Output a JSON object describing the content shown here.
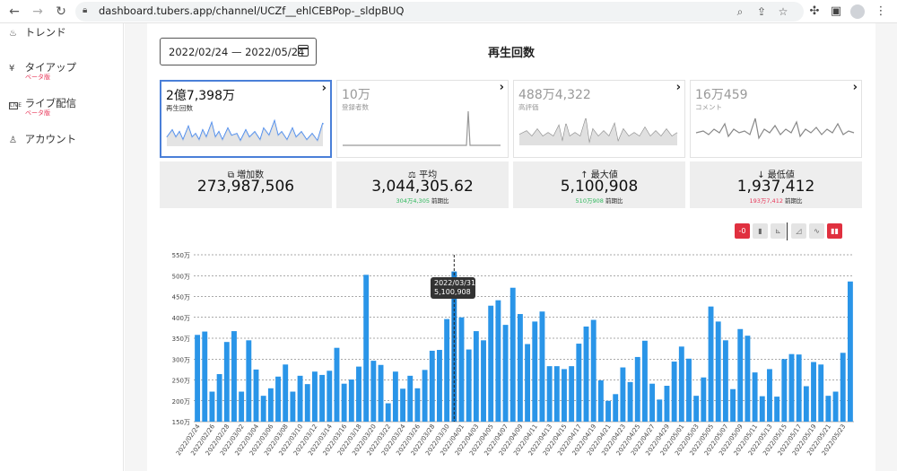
{
  "browser": {
    "url": "dashboard.tubers.app/channel/UCZf__ehlCEBPop-_sldpBUQ"
  },
  "sidebar": {
    "items": [
      {
        "label": "トレンド",
        "icon": "trend-icon",
        "sub": ""
      },
      {
        "label": "タイアップ",
        "icon": "yen-icon",
        "sub": "ベータ版"
      },
      {
        "label": "ライブ配信",
        "icon": "live-icon",
        "sub": "ベータ版"
      },
      {
        "label": "アカウント",
        "icon": "person-icon",
        "sub": ""
      }
    ]
  },
  "header": {
    "date_range": "2022/02/24 — 2022/05/24",
    "title": "再生回数"
  },
  "cards": [
    {
      "value": "2億7,398万",
      "label": "再生回数",
      "active": true
    },
    {
      "value": "10万",
      "label": "登録者数",
      "active": false
    },
    {
      "value": "488万4,322",
      "label": "高評価",
      "active": false
    },
    {
      "value": "16万459",
      "label": "コメント",
      "active": false
    }
  ],
  "stats": [
    {
      "label": "増加数",
      "icon": "trend-chart-icon",
      "value": "273,987,506",
      "diff": "",
      "diff_label": "",
      "diff_color": ""
    },
    {
      "label": "平均",
      "icon": "scale-icon",
      "value": "3,044,305.62",
      "diff": "304万4,305",
      "diff_label": "前期比",
      "diff_color": "green"
    },
    {
      "label": "最大値",
      "icon": "arrow-up-icon",
      "value": "5,100,908",
      "diff": "510万908",
      "diff_label": "前期比",
      "diff_color": "green"
    },
    {
      "label": "最低値",
      "icon": "arrow-down-icon",
      "value": "1,937,412",
      "diff": "193万7,412",
      "diff_label": "前期比",
      "diff_color": "red"
    }
  ],
  "toolbar": {
    "items": [
      {
        "name": "toggle-zero-button",
        "label": "-0",
        "style": "red"
      },
      {
        "name": "bar-growth-button",
        "label": "▮",
        "style": "grey"
      },
      {
        "name": "axis-button",
        "label": "⊾",
        "style": "grey"
      },
      {
        "name": "area-chart-button",
        "label": "◿",
        "style": "grey"
      },
      {
        "name": "line-chart-button",
        "label": "∿",
        "style": "grey"
      },
      {
        "name": "bar-chart-button",
        "label": "▮▮",
        "style": "red"
      }
    ]
  },
  "tooltip": {
    "date": "2022/03/31",
    "value": "5,100,908"
  },
  "colors": {
    "accent": "#4a7fd8",
    "bar": "#2a95e8",
    "red": "#e0303f",
    "green": "#2eb85c"
  },
  "chart_data": {
    "type": "bar",
    "ylim": [
      150,
      550
    ],
    "yunit": "万",
    "y_ticks": [
      "150万",
      "200万",
      "250万",
      "300万",
      "350万",
      "400万",
      "450万",
      "500万",
      "550万"
    ],
    "x_tick_labels": [
      "2022/02/24",
      "2022/02/26",
      "2022/02/28",
      "2022/03/02",
      "2022/03/04",
      "2022/03/06",
      "2022/03/08",
      "2022/03/10",
      "2022/03/12",
      "2022/03/14",
      "2022/03/16",
      "2022/03/18",
      "2022/03/20",
      "2022/03/22",
      "2022/03/24",
      "2022/03/26",
      "2022/03/28",
      "2022/03/30",
      "2022/04/01",
      "2022/04/03",
      "2022/04/05",
      "2022/04/07",
      "2022/04/09",
      "2022/04/11",
      "2022/04/13",
      "2022/04/15",
      "2022/04/17",
      "2022/04/19",
      "2022/04/21",
      "2022/04/23",
      "2022/04/25",
      "2022/04/27",
      "2022/04/29",
      "2022/05/01",
      "2022/05/03",
      "2022/05/05",
      "2022/05/07",
      "2022/05/09",
      "2022/05/11",
      "2022/05/13",
      "2022/05/15",
      "2022/05/17",
      "2022/05/19",
      "2022/05/21",
      "2022/05/23"
    ],
    "values": [
      358,
      366,
      222,
      264,
      341,
      367,
      222,
      345,
      275,
      212,
      230,
      258,
      287,
      222,
      260,
      240,
      270,
      262,
      272,
      327,
      241,
      251,
      282,
      502,
      296,
      286,
      194,
      270,
      229,
      260,
      230,
      274,
      320,
      322,
      396,
      510,
      400,
      323,
      367,
      345,
      428,
      441,
      382,
      471,
      408,
      336,
      390,
      414,
      283,
      283,
      276,
      283,
      337,
      378,
      394,
      249,
      200,
      216,
      280,
      245,
      305,
      344,
      241,
      203,
      236,
      294,
      330,
      301,
      212,
      256,
      426,
      390,
      345,
      228,
      372,
      356,
      268,
      211,
      276,
      210,
      300,
      312,
      311,
      235,
      293,
      287,
      212,
      222,
      315,
      486
    ],
    "highlight_index": 35
  }
}
